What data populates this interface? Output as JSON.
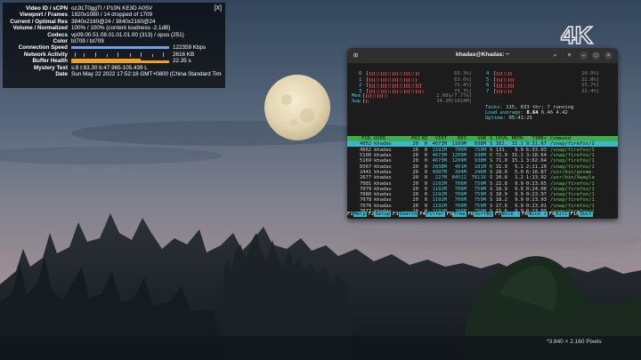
{
  "stats": {
    "close_label": "[X]",
    "rows": [
      {
        "label": "Video ID / sCPN",
        "value": "ozJtLT0ggTI / P10N KE3D A0SV"
      },
      {
        "label": "Viewport / Frames",
        "value": "1920x1080 / 14 dropped of 1709"
      },
      {
        "label": "Current / Optimal Res",
        "value": "3840x2160@24 / 3840x2160@24"
      },
      {
        "label": "Volume / Normalized",
        "value": "100% / 100% (content loudness -2.1dB)"
      },
      {
        "label": "Codecs",
        "value": "vp09.00.51.08.01.01.01.00 (313) / opus (251)"
      },
      {
        "label": "Color",
        "value": "bt709 / bt709"
      },
      {
        "label": "Connection Speed",
        "value": "122359 Kbps"
      },
      {
        "label": "Network Activity",
        "value": "2616 KB"
      },
      {
        "label": "Buffer Health",
        "value": "22.35 s"
      },
      {
        "label": "Mystery Text",
        "value": "s:8 t:83.30 b:47.965-105.439 L"
      },
      {
        "label": "Date",
        "value": "Sun May 22 2022 17:52:18 GMT+0800 (China Standard Time)"
      }
    ]
  },
  "watermark": {
    "logo": "4K",
    "pixels": "*3.840 × 2.160 Pixels"
  },
  "terminal": {
    "title": "khadas@Khadas: ~",
    "cpus_left": [
      {
        "id": "0",
        "pct": "69.3%",
        "level": 0.69
      },
      {
        "id": "1",
        "pct": "63.6%",
        "level": 0.64
      },
      {
        "id": "2",
        "pct": "72.4%",
        "level": 0.72
      },
      {
        "id": "3",
        "pct": "73.7%",
        "level": 0.74
      }
    ],
    "cpus_right": [
      {
        "id": "4",
        "pct": "20.9%",
        "level": 0.21
      },
      {
        "id": "5",
        "pct": "22.8%",
        "level": 0.23
      },
      {
        "id": "6",
        "pct": "23.7%",
        "level": 0.24
      },
      {
        "id": "7",
        "pct": "22.4%",
        "level": 0.22
      }
    ],
    "mem": {
      "label": "Mem",
      "value": "2.00G/7.77G",
      "level": 0.26
    },
    "swp": {
      "label": "Swp",
      "value": "34.2M/1024M",
      "level": 0.03
    },
    "tasks": {
      "label": "Tasks:",
      "value": "115, 633 thr; 7 running"
    },
    "load": {
      "label": "Load average:",
      "v1": "8.64",
      "rest": "6.46 4.42"
    },
    "uptime": {
      "label": "Uptime:",
      "value": "05:41:25"
    },
    "columns": [
      "PID",
      "USER",
      "PRI",
      "NI",
      "VIRT",
      "RES",
      "SHR",
      "S",
      "CPU%",
      "MEM%",
      "TIME+",
      "Command"
    ],
    "processes": [
      {
        "pid": "4052",
        "user": "khadas",
        "pri": "20",
        "ni": "0",
        "virt": "4673M",
        "res": "1109M",
        "shr": "938M",
        "s": "S",
        "cpu": "162.",
        "mem": "15.1",
        "time": "9:31.67",
        "cmd": "/snap/firefox/1"
      },
      {
        "pid": "4662",
        "user": "khadas",
        "pri": "20",
        "ni": "0",
        "virt": "1192M",
        "res": "706M",
        "shr": "759M",
        "s": "S",
        "cpu": "131.",
        "mem": "9.9",
        "time": "6:33.03",
        "cmd": "/snap/firefox/1"
      },
      {
        "pid": "5100",
        "user": "khadas",
        "pri": "20",
        "ni": "0",
        "virt": "4673M",
        "res": "1209M",
        "shr": "938M",
        "s": "R",
        "cpu": "72.9",
        "mem": "15.1",
        "time": "3:18.64",
        "cmd": "/snap/firefox/1"
      },
      {
        "pid": "5169",
        "user": "khadas",
        "pri": "20",
        "ni": "0",
        "virt": "4673M",
        "res": "1209M",
        "shr": "938M",
        "s": "S",
        "cpu": "71.0",
        "mem": "15.1",
        "time": "3:02.64",
        "cmd": "/snap/firefox/1"
      },
      {
        "pid": "6567",
        "user": "khadas",
        "pri": "20",
        "ni": "0",
        "virt": "2838M",
        "res": "401M",
        "shr": "181M",
        "s": "R",
        "cpu": "31.9",
        "mem": "5.1",
        "time": "2:11.20",
        "cmd": "/snap/firefox/1"
      },
      {
        "pid": "2441",
        "user": "khadas",
        "pri": "20",
        "ni": "0",
        "virt": "4997M",
        "res": "394M",
        "shr": "246M",
        "s": "S",
        "cpu": "28.0",
        "mem": "5.0",
        "time": "6:16.87",
        "cmd": "/usr/bin/gnome-"
      },
      {
        "pid": "2677",
        "user": "khadas",
        "pri": "20",
        "ni": "0",
        "virt": "227M",
        "res": "84512",
        "shr": "78116",
        "s": "S",
        "cpu": "20.8",
        "mem": "1.2",
        "time": "1:13.92",
        "cmd": "/usr/bin/Xwayla"
      },
      {
        "pid": "7081",
        "user": "khadas",
        "pri": "20",
        "ni": "0",
        "virt": "1192M",
        "res": "706M",
        "shr": "759M",
        "s": "S",
        "cpu": "22.8",
        "mem": "9.9",
        "time": "0:23.65",
        "cmd": "/snap/firefox/1"
      },
      {
        "pid": "7079",
        "user": "khadas",
        "pri": "20",
        "ni": "0",
        "virt": "1192M",
        "res": "706M",
        "shr": "759M",
        "s": "S",
        "cpu": "18.9",
        "mem": "9.9",
        "time": "0:24.00",
        "cmd": "/snap/firefox/1"
      },
      {
        "pid": "7080",
        "user": "khadas",
        "pri": "20",
        "ni": "0",
        "virt": "1192M",
        "res": "706M",
        "shr": "759M",
        "s": "S",
        "cpu": "18.9",
        "mem": "9.9",
        "time": "0:23.97",
        "cmd": "/snap/firefox/1"
      },
      {
        "pid": "7078",
        "user": "khadas",
        "pri": "20",
        "ni": "0",
        "virt": "1192M",
        "res": "706M",
        "shr": "759M",
        "s": "S",
        "cpu": "18.2",
        "mem": "9.9",
        "time": "0:23.93",
        "cmd": "/snap/firefox/1"
      },
      {
        "pid": "7076",
        "user": "khadas",
        "pri": "20",
        "ni": "0",
        "virt": "1192M",
        "res": "706M",
        "shr": "759M",
        "s": "S",
        "cpu": "17.6",
        "mem": "9.9",
        "time": "0:23.01",
        "cmd": "/snap/firefox/1"
      },
      {
        "pid": "7077",
        "user": "khadas",
        "pri": "20",
        "ni": "0",
        "virt": "1192M",
        "res": "706M",
        "shr": "759M",
        "s": "S",
        "cpu": "15.6",
        "mem": "9.9",
        "time": "0:23.09",
        "cmd": "/snap/firefox/1"
      }
    ],
    "fkeys": [
      {
        "key": "F1",
        "label": "Help"
      },
      {
        "key": "F2",
        "label": "Setup"
      },
      {
        "key": "F3",
        "label": "Search"
      },
      {
        "key": "F4",
        "label": "Filter"
      },
      {
        "key": "F5",
        "label": "Tree"
      },
      {
        "key": "F6",
        "label": "SortBy"
      },
      {
        "key": "F7",
        "label": "Nice -"
      },
      {
        "key": "F8",
        "label": "Nice +"
      },
      {
        "key": "F9",
        "label": "Kill"
      },
      {
        "key": "F10",
        "label": "Quit"
      }
    ],
    "colors": {
      "header_bg": "#3fae4a",
      "selected_bg": "#39b8cc",
      "meter_red": "#d44"
    }
  }
}
